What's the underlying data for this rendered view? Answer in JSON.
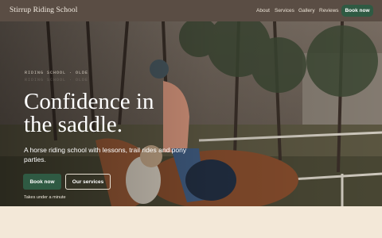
{
  "brand": {
    "name": "Stirrup Riding School"
  },
  "nav": {
    "links": [
      "About",
      "Services",
      "Gallery",
      "Reviews"
    ],
    "cta": "Book now"
  },
  "hero": {
    "eyebrow": "RIDING SCHOOL · OLDE",
    "eyebrow_ghost": "RIDING SCHOOL · OLDE",
    "headline_line1": "Confidence in",
    "headline_line2": "the saddle.",
    "subheadline": "A horse riding school with lessons, trail rides and pony parties.",
    "primary_button": "Book now",
    "secondary_button": "Our services",
    "note": "Takes under a minute"
  },
  "colors": {
    "nav_bg": "#5a4d44",
    "accent_green": "#2f5a43",
    "page_bg": "#f3e8d8"
  }
}
